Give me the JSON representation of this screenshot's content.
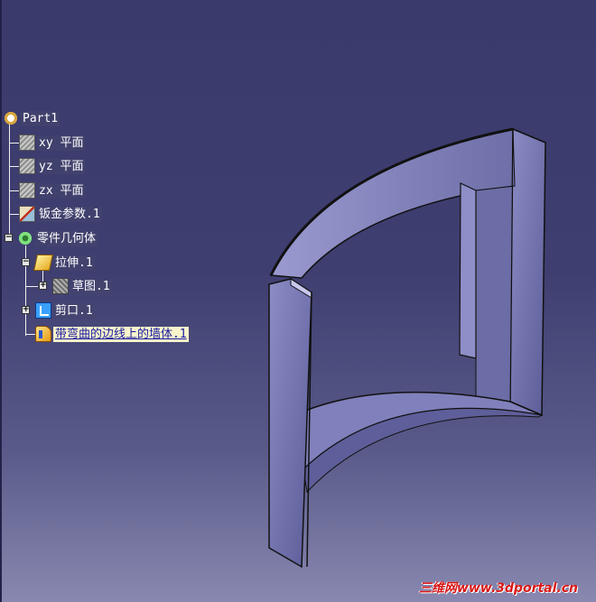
{
  "tree": {
    "root": {
      "label": "Part1",
      "icon": "part-icon"
    },
    "items": [
      {
        "label": "xy 平面",
        "icon": "plane-icon"
      },
      {
        "label": "yz 平面",
        "icon": "plane-icon"
      },
      {
        "label": "zx 平面",
        "icon": "plane-icon"
      },
      {
        "label": "钣金参数.1",
        "icon": "sheetmetal-params-icon"
      },
      {
        "label": "零件几何体",
        "icon": "body-icon"
      },
      {
        "label": "拉伸.1",
        "icon": "extrude-icon"
      },
      {
        "label": "草图.1",
        "icon": "sketch-icon"
      },
      {
        "label": "剪口.1",
        "icon": "cutout-icon"
      },
      {
        "label": "带弯曲的边线上的墙体.1",
        "icon": "wall-on-edge-icon"
      }
    ],
    "expanders": {
      "collapsed": "+",
      "expanded": "−"
    }
  },
  "watermark": {
    "text": "三维网www.3dportal.cn"
  },
  "colors": {
    "background_top": "#3a3a6c",
    "background_bottom": "#8888b0",
    "part_face": "#7e7eb8",
    "selected_label_bg": "#f8f4cc",
    "watermark": "#d81818"
  }
}
